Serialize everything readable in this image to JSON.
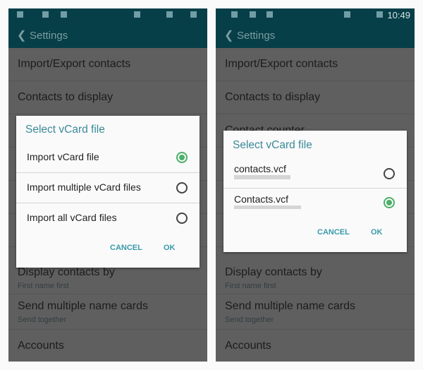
{
  "statusbar": {
    "time": "10:49"
  },
  "appbar": {
    "back_icon": "chevron-left-icon",
    "title": "Settings"
  },
  "settings": {
    "import_export": "Import/Export contacts",
    "contacts_to_display": "Contacts to display",
    "contact_counter": "Contact counter",
    "display_contacts_by": {
      "title": "Display contacts by",
      "subtitle": "First name first"
    },
    "send_multiple": {
      "title": "Send multiple name cards",
      "subtitle": "Send together"
    },
    "accounts": "Accounts"
  },
  "dialog_left": {
    "title": "Select vCard file",
    "options": [
      {
        "label": "Import vCard file",
        "selected": true
      },
      {
        "label": "Import multiple vCard files",
        "selected": false
      },
      {
        "label": "Import all vCard files",
        "selected": false
      }
    ],
    "cancel": "CANCEL",
    "ok": "OK"
  },
  "dialog_right": {
    "title": "Select vCard file",
    "options": [
      {
        "label": "contacts.vcf",
        "selected": false
      },
      {
        "label": "Contacts.vcf",
        "selected": true
      }
    ],
    "cancel": "CANCEL",
    "ok": "OK"
  },
  "colors": {
    "appbar": "#063f48",
    "accent": "#3a8a99",
    "radio_selected": "#4caf6a"
  }
}
